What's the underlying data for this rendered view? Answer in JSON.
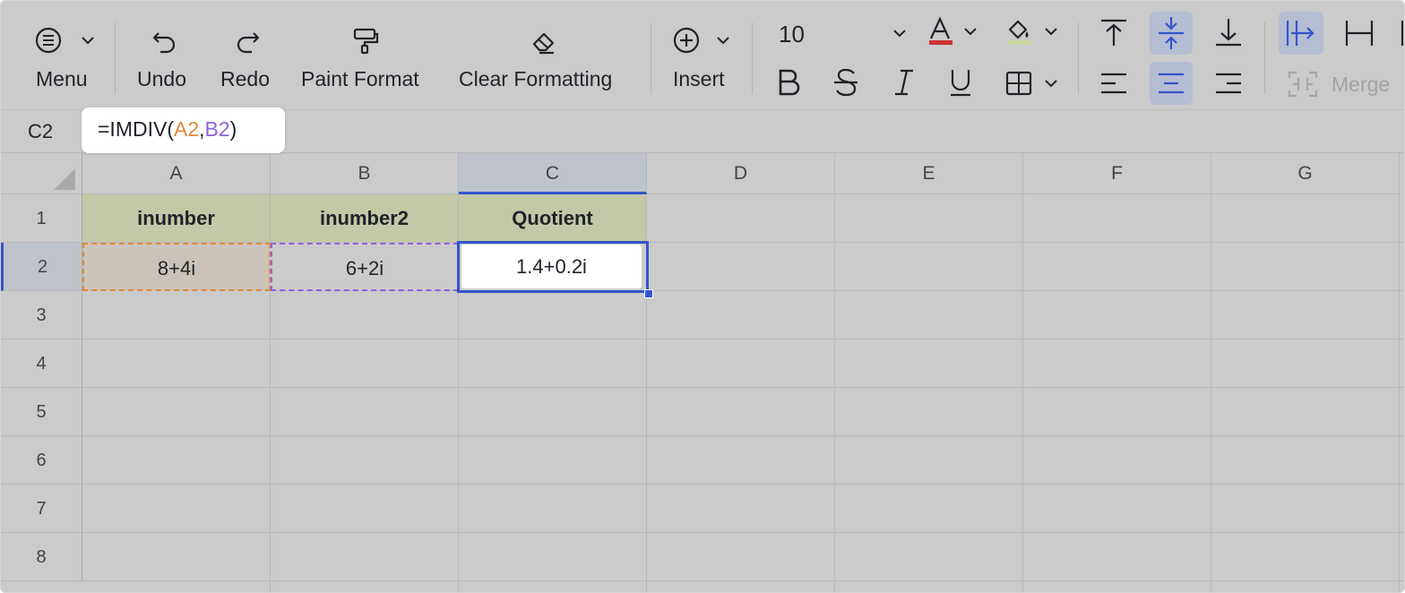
{
  "toolbar": {
    "menu_label": "Menu",
    "undo_label": "Undo",
    "redo_label": "Redo",
    "paint_format_label": "Paint Format",
    "clear_formatting_label": "Clear Formatting",
    "insert_label": "Insert",
    "font_size": "10",
    "merge_label": "Merge",
    "font_color": "#cc3333",
    "fill_color": "#c8d6a0"
  },
  "formula_bar": {
    "cell_ref": "C2",
    "formula_prefix": "=IMDIV(",
    "ref1": "A2",
    "comma": ",",
    "ref2": "B2",
    "formula_suffix": ")"
  },
  "sheet": {
    "columns": [
      "A",
      "B",
      "C",
      "D",
      "E",
      "F",
      "G"
    ],
    "rows": [
      "1",
      "2",
      "3",
      "4",
      "5",
      "6",
      "7",
      "8"
    ],
    "header_row": [
      "inumber",
      "inumber2",
      "Quotient"
    ],
    "data_row": [
      "8+4i",
      "6+2i",
      "1.4+0.2i"
    ],
    "selected_cell": "C2"
  }
}
